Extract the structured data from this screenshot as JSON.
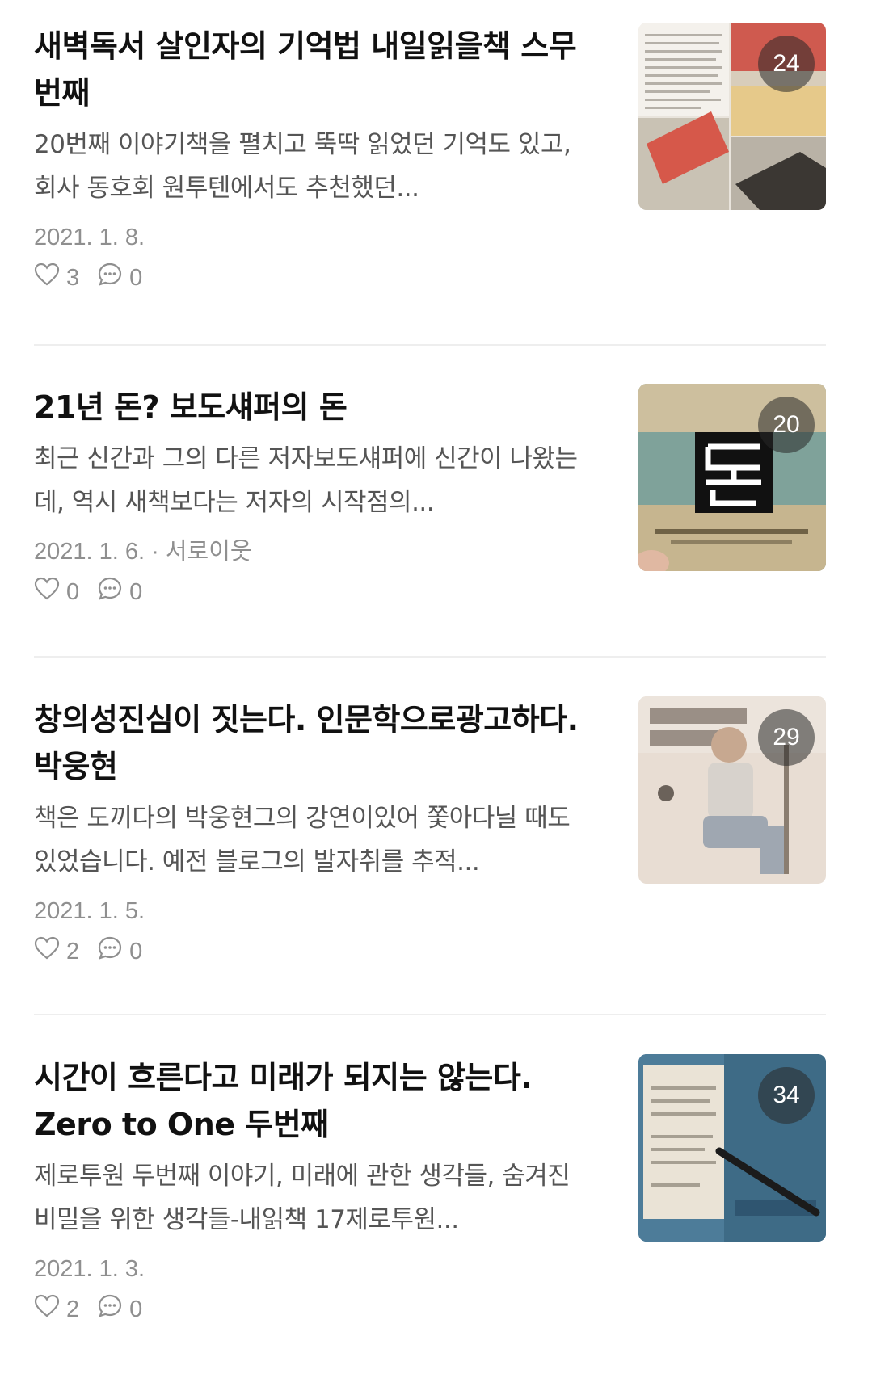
{
  "posts": [
    {
      "title": "새벽독서 살인자의 기억법 내일읽을책 스무번째",
      "snippet": "20번째 이야기책을 펼치고 뚝딱 읽었던 기억도 있고, 회사 동호회 원투텐에서도 추천했던...",
      "date": "2021. 1. 8.",
      "likes": "3",
      "comments": "0",
      "photo_count": "24"
    },
    {
      "title": "21년 돈? 보도섀퍼의 돈",
      "snippet": "최근 신간과 그의 다른 저자보도섀퍼에 신간이 나왔는데, 역시 새책보다는 저자의 시작점의...",
      "date": "2021. 1. 6. · 서로이웃",
      "likes": "0",
      "comments": "0",
      "photo_count": "20"
    },
    {
      "title": "창의성진심이 짓는다. 인문학으로광고하다. 박웅현",
      "snippet": "책은 도끼다의 박웅현그의 강연이있어 쫓아다닐 때도 있었습니다. 예전 블로그의 발자취를 추적...",
      "date": "2021. 1. 5.",
      "likes": "2",
      "comments": "0",
      "photo_count": "29"
    },
    {
      "title": "시간이 흐른다고 미래가 되지는 않는다. Zero to One 두번째",
      "snippet": "제로투원 두번째 이야기, 미래에 관한 생각들, 숨겨진 비밀을 위한 생각들-내읽책 17제로투원...",
      "date": "2021. 1. 3.",
      "likes": "2",
      "comments": "0",
      "photo_count": "34"
    }
  ],
  "icons": {
    "like": "heart-icon",
    "comment": "comment-bubble-icon"
  },
  "colors": {
    "title": "#111111",
    "snippet": "#555555",
    "meta": "#8f8f8f",
    "divider": "#eeeeee"
  }
}
